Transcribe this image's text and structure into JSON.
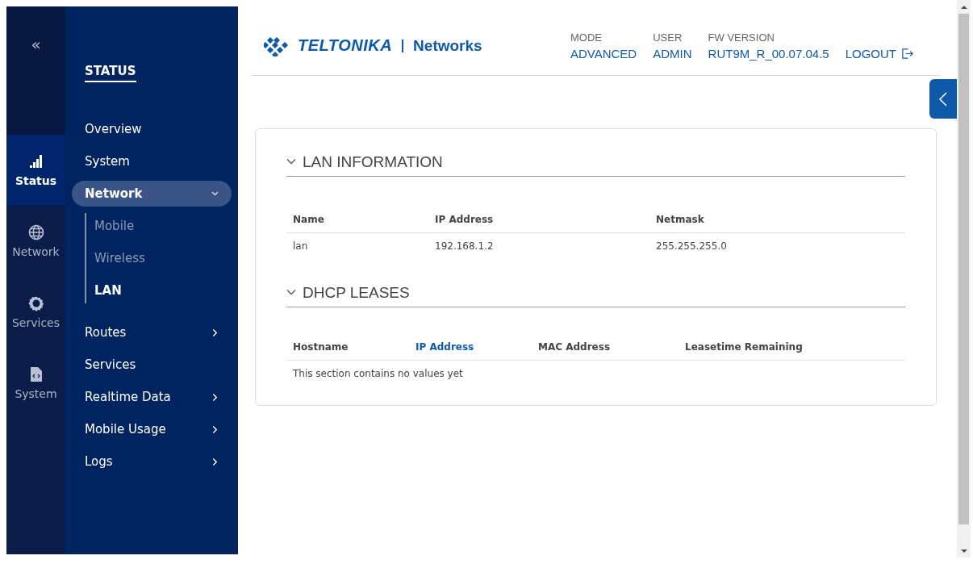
{
  "rail": {
    "collapse_label": "«",
    "items": [
      {
        "label": "Status",
        "selected": true
      },
      {
        "label": "Network",
        "selected": false
      },
      {
        "label": "Services",
        "selected": false
      },
      {
        "label": "System",
        "selected": false
      }
    ]
  },
  "nav": {
    "title": "STATUS",
    "items": [
      {
        "label": "Overview",
        "selected": false,
        "has_submenu": false
      },
      {
        "label": "System",
        "selected": false,
        "has_submenu": false
      },
      {
        "label": "Network",
        "selected": true,
        "has_submenu": true,
        "expanded": true,
        "children": [
          {
            "label": "Mobile",
            "selected": false
          },
          {
            "label": "Wireless",
            "selected": false
          },
          {
            "label": "LAN",
            "selected": true
          }
        ]
      },
      {
        "label": "Routes",
        "selected": false,
        "has_submenu": true,
        "expanded": false
      },
      {
        "label": "Services",
        "selected": false,
        "has_submenu": false
      },
      {
        "label": "Realtime Data",
        "selected": false,
        "has_submenu": true,
        "expanded": false
      },
      {
        "label": "Mobile Usage",
        "selected": false,
        "has_submenu": true,
        "expanded": false
      },
      {
        "label": "Logs",
        "selected": false,
        "has_submenu": true,
        "expanded": false
      }
    ]
  },
  "header": {
    "logo": "TELTONIKA",
    "logo_suffix": "Networks",
    "info": [
      {
        "label": "MODE",
        "value": "ADVANCED"
      },
      {
        "label": "USER",
        "value": "ADMIN"
      },
      {
        "label": "FW VERSION",
        "value": "RUT9M_R_00.07.04.5"
      }
    ],
    "logout": "LOGOUT"
  },
  "sections": [
    {
      "title": "LAN INFORMATION",
      "expanded": true,
      "columns": [
        {
          "label": "Name",
          "sorted": false
        },
        {
          "label": "IP Address",
          "sorted": false
        },
        {
          "label": "Netmask",
          "sorted": false
        }
      ],
      "rows": [
        [
          "lan",
          "192.168.1.2",
          "255.255.255.0"
        ]
      ]
    },
    {
      "title": "DHCP LEASES",
      "expanded": true,
      "columns": [
        {
          "label": "Hostname",
          "sorted": false
        },
        {
          "label": "IP Address",
          "sorted": true
        },
        {
          "label": "MAC Address",
          "sorted": false
        },
        {
          "label": "Leasetime Remaining",
          "sorted": false
        }
      ],
      "empty_message": "This section contains no values yet"
    }
  ]
}
